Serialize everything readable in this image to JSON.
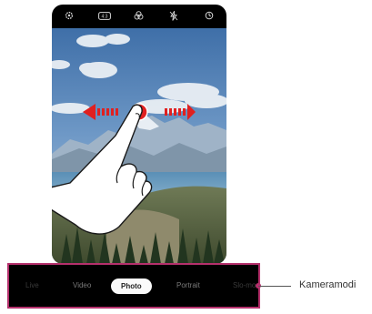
{
  "top_bar": {
    "icons": [
      "settings-icon",
      "hdr-badge-icon",
      "filter-icon",
      "flash-off-icon",
      "timer-icon"
    ],
    "hdr_label": "4:3"
  },
  "modes": {
    "items": [
      "Live",
      "Video",
      "Photo",
      "Portrait",
      "Slo-mo"
    ],
    "selected": "Photo"
  },
  "callout": {
    "label": "Kameramodi"
  },
  "colors": {
    "swipe_arrow": "#e02020",
    "highlight_frame": "#b5306c"
  }
}
